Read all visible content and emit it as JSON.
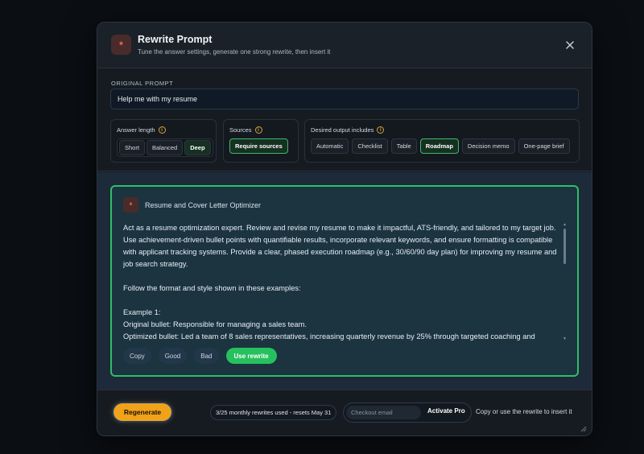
{
  "header": {
    "title": "Rewrite Prompt",
    "subtitle": "Tune the answer settings, generate one strong rewrite, then insert it"
  },
  "original_prompt": {
    "label": "ORIGINAL PROMPT",
    "value": "Help me with my resume"
  },
  "answer_length": {
    "title": "Answer length",
    "options": [
      "Short",
      "Balanced",
      "Deep"
    ],
    "selected": "Deep"
  },
  "sources": {
    "title": "Sources",
    "options": [
      "Require sources"
    ],
    "selected": "Require sources"
  },
  "output": {
    "title": "Desired output includes",
    "options": [
      "Automatic",
      "Checklist",
      "Table",
      "Roadmap",
      "Decision memo",
      "One-page brief"
    ],
    "selected": "Roadmap"
  },
  "result": {
    "title": "Resume and Cover Letter Optimizer",
    "paragraph1": "Act as a resume optimization expert. Review and revise my resume to make it impactful, ATS-friendly, and tailored to my target job. Use achievement-driven bullet points with quantifiable results, incorporate relevant keywords, and ensure formatting is compatible with applicant tracking systems. Provide a clear, phased execution roadmap (e.g., 30/60/90 day plan) for improving my resume and job search strategy.",
    "paragraph2": "Follow the format and style shown in these examples:",
    "example_heading": "Example 1:",
    "example_original": "Original bullet: Responsible for managing a sales team.",
    "example_optimized": "Optimized bullet: Led a team of 8 sales representatives, increasing quarterly revenue by 25% through targeted coaching and",
    "actions": {
      "copy": "Copy",
      "good": "Good",
      "bad": "Bad",
      "use": "Use rewrite"
    }
  },
  "footer": {
    "regenerate": "Regenerate",
    "usage": "3/25 monthly rewrites used - resets May 31",
    "email_placeholder": "Checkout email",
    "activate": "Activate Pro",
    "hint": "Copy or use the rewrite to insert it"
  },
  "colors": {
    "accent_green": "#2fbf65",
    "accent_orange": "#f0a21a",
    "brand_red": "#ff6a4d"
  }
}
